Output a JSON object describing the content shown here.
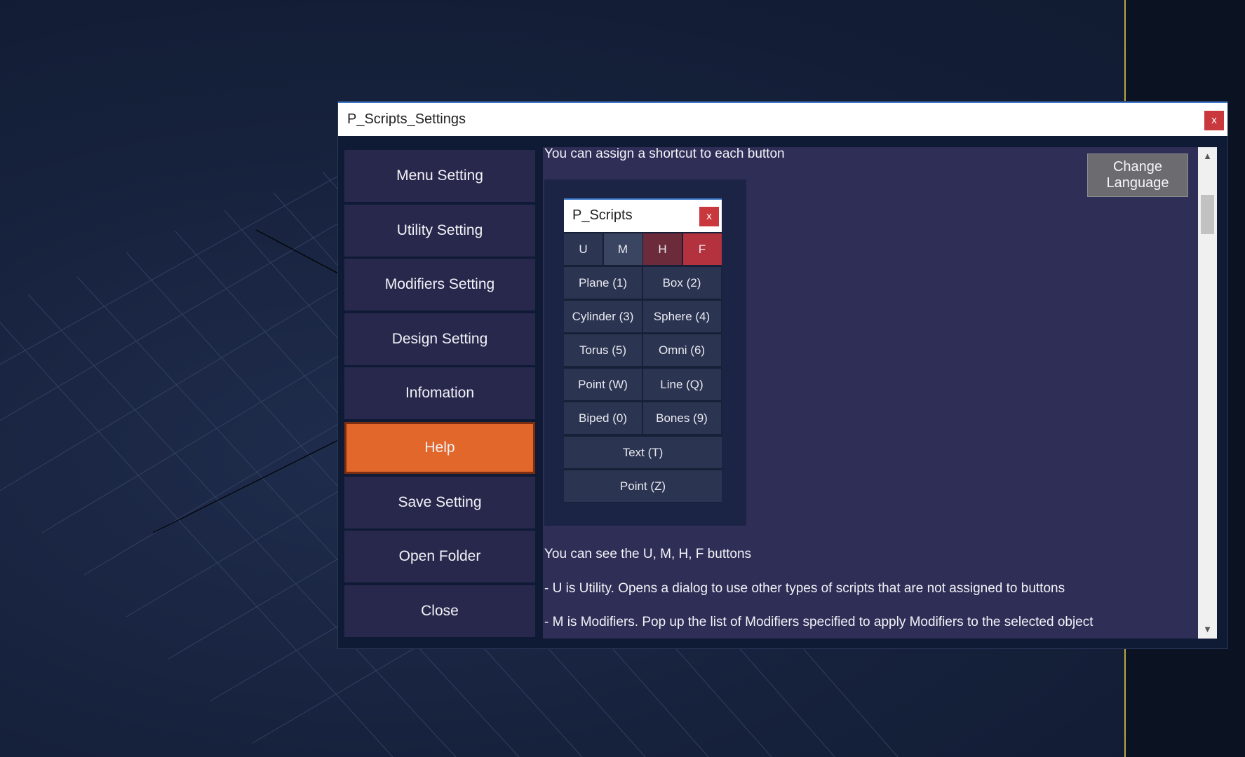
{
  "window": {
    "title": "P_Scripts_Settings",
    "close_label": "x"
  },
  "sidebar": {
    "items": [
      {
        "label": "Menu Setting"
      },
      {
        "label": "Utility Setting"
      },
      {
        "label": "Modifiers Setting"
      },
      {
        "label": "Design Setting"
      },
      {
        "label": "Infomation"
      },
      {
        "label": "Help",
        "active": true
      },
      {
        "label": "Save Setting"
      },
      {
        "label": "Open Folder"
      },
      {
        "label": "Close"
      }
    ]
  },
  "content": {
    "intro": "You can assign a shortcut to each button",
    "change_language": "Change Language",
    "lines": [
      "You can see the U, M, H,  F buttons",
      "- U is Utility. Opens a dialog to use other types of scripts that are not assigned to buttons",
      "- M is Modifiers. Pop up the list of Modifiers specified to apply Modifiers to the selected object"
    ]
  },
  "mini_window": {
    "title": "P_Scripts",
    "close_label": "x",
    "tabs": [
      "U",
      "M",
      "H",
      "F"
    ],
    "grid": [
      [
        "Plane (1)",
        "Box (2)"
      ],
      [
        "Cylinder (3)",
        "Sphere (4)"
      ],
      [
        "Torus (5)",
        "Omni (6)"
      ],
      [
        "Point (W)",
        "Line (Q)"
      ],
      [
        "Biped (0)",
        "Bones (9)"
      ]
    ],
    "full_rows": [
      "Text (T)",
      "Point (Z)"
    ]
  },
  "scrollbar": {
    "up_icon": "chevron-up-icon",
    "down_icon": "chevron-down-icon"
  },
  "colors": {
    "accent_active": "#e1672b",
    "menu_button": "#28284d",
    "content_bg": "#2f2e57",
    "close_button": "#c9383d",
    "tab_f": "#b3323e",
    "tab_h": "#6c2b3a"
  }
}
